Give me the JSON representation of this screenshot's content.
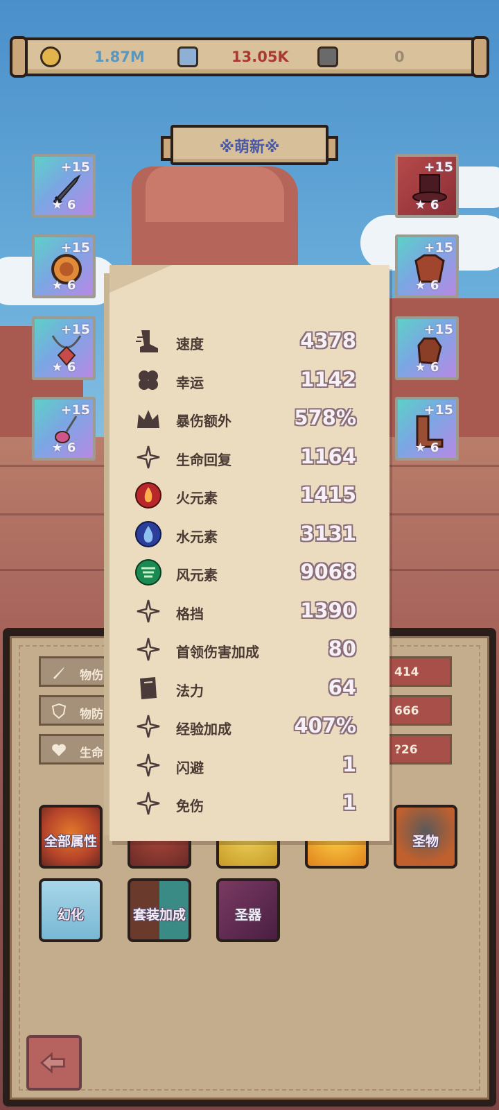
{
  "resources": [
    {
      "icon": "gold-coin-icon",
      "value": "1.87M",
      "color": "#5a97bf"
    },
    {
      "icon": "blue-crystal-icon",
      "value": "13.05K",
      "color": "#a83a35"
    },
    {
      "icon": "rune-stone-icon",
      "value": "0",
      "color": "#9a8a70"
    }
  ],
  "title": "※萌新※",
  "equipment": {
    "left": [
      {
        "icon": "sword-icon",
        "plus": "+15",
        "stars": "★ 6"
      },
      {
        "icon": "ring-icon",
        "plus": "+15",
        "stars": "★ 6"
      },
      {
        "icon": "necklace-icon",
        "plus": "+15",
        "stars": "★ 6"
      },
      {
        "icon": "amulet-icon",
        "plus": "+15",
        "stars": "★ 6"
      }
    ],
    "right": [
      {
        "icon": "hat-icon",
        "plus": "+15",
        "stars": "★ 6"
      },
      {
        "icon": "armor-icon",
        "plus": "+15",
        "stars": "★ 6"
      },
      {
        "icon": "gloves-icon",
        "plus": "+15",
        "stars": "★ 6"
      },
      {
        "icon": "boots-icon",
        "plus": "+15",
        "stars": "★ 6"
      }
    ]
  },
  "stats_popup": {
    "rows": [
      {
        "icon": "boot-speed-icon",
        "name": "速度",
        "value": "4378"
      },
      {
        "icon": "clover-luck-icon",
        "name": "幸运",
        "value": "1142"
      },
      {
        "icon": "crown-crit-icon",
        "name": "暴伤额外",
        "value": "578%"
      },
      {
        "icon": "sparkle-icon",
        "name": "生命回复",
        "value": "1164"
      },
      {
        "icon": "fire-element-icon",
        "name": "火元素",
        "value": "1415"
      },
      {
        "icon": "water-element-icon",
        "name": "水元素",
        "value": "3131"
      },
      {
        "icon": "wind-element-icon",
        "name": "风元素",
        "value": "9068"
      },
      {
        "icon": "sparkle-icon",
        "name": "格挡",
        "value": "1390"
      },
      {
        "icon": "sparkle-icon",
        "name": "首领伤害加成",
        "value": "80"
      },
      {
        "icon": "spellbook-icon",
        "name": "法力",
        "value": "64"
      },
      {
        "icon": "sparkle-icon",
        "name": "经验加成",
        "value": "407%"
      },
      {
        "icon": "sparkle-icon",
        "name": "闪避",
        "value": "1"
      },
      {
        "icon": "sparkle-icon",
        "name": "免伤",
        "value": "1"
      }
    ]
  },
  "panel": {
    "left_stats": [
      {
        "icon": "sword-stat-icon",
        "label": "物伤"
      },
      {
        "icon": "shield-stat-icon",
        "label": "物防"
      },
      {
        "icon": "heart-stat-icon",
        "label": "生命"
      }
    ],
    "right_stats": [
      {
        "value": "414"
      },
      {
        "value": "666"
      },
      {
        "value": "?26"
      }
    ],
    "buttons_row1": [
      {
        "label": "全部属性",
        "icon": "all-attributes-icon"
      },
      {
        "label": "",
        "icon": "skill-icon"
      },
      {
        "label": "",
        "icon": "pet-icon"
      },
      {
        "label": "",
        "icon": "light-icon"
      },
      {
        "label": "圣物",
        "icon": "relic-icon"
      }
    ],
    "buttons_row2": [
      {
        "label": "幻化",
        "icon": "transform-icon"
      },
      {
        "label": "套装加成",
        "icon": "set-bonus-icon"
      },
      {
        "label": "圣器",
        "icon": "holy-artifact-icon"
      }
    ]
  },
  "colors": {
    "panel_bg": "#c4ad8c",
    "value_outline": "#8a6f7a",
    "title_text": "#4a5aa8"
  }
}
